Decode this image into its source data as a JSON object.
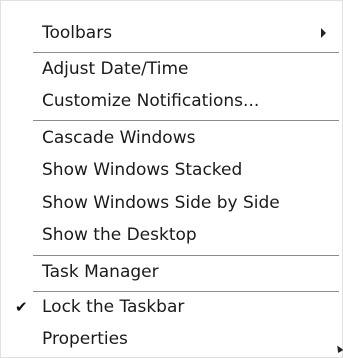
{
  "menu": {
    "items": [
      {
        "label": "Toolbars",
        "has_submenu": true
      },
      {
        "label": "Adjust Date/Time"
      },
      {
        "label": "Customize Notifications..."
      },
      {
        "label": "Cascade Windows"
      },
      {
        "label": "Show Windows Stacked"
      },
      {
        "label": "Show Windows Side by Side"
      },
      {
        "label": "Show the Desktop"
      },
      {
        "label": "Task Manager"
      },
      {
        "label": "Lock the Taskbar",
        "checked": true,
        "check_glyph": "✔"
      },
      {
        "label": "Properties"
      }
    ]
  },
  "icons": {
    "submenu": "chevron-right-icon",
    "check": "checkmark-icon",
    "cursor": "mouse-pointer-icon"
  },
  "colors": {
    "background": "#ffffff",
    "text": "#1a1a1a",
    "separator": "#8c8c8c"
  }
}
